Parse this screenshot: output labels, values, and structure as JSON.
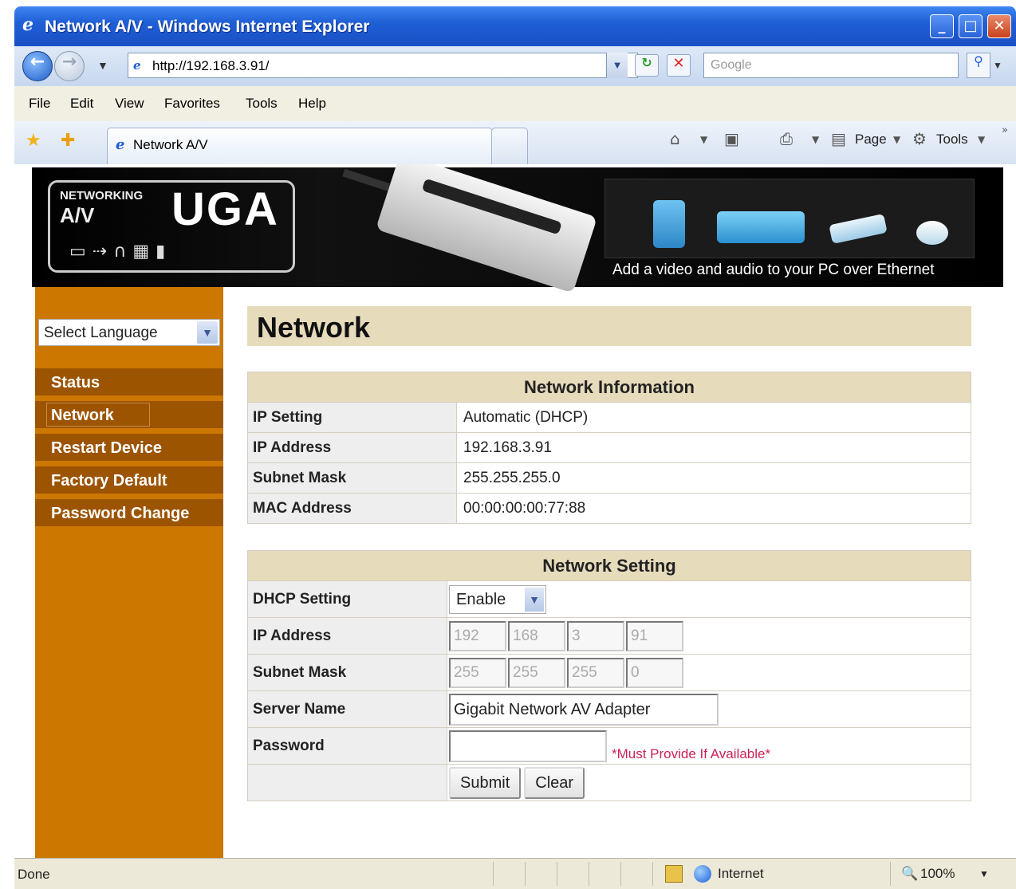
{
  "window": {
    "title": "Network A/V - Windows Internet Explorer",
    "minimize": "_",
    "maximize": "□",
    "close": "✕"
  },
  "address_bar": {
    "url": "http://192.168.3.91/",
    "search_placeholder": "Google"
  },
  "menu": [
    "File",
    "Edit",
    "View",
    "Favorites",
    "Tools",
    "Help"
  ],
  "tabs": {
    "active_tab_label": "Network A/V",
    "toolbar_page": "Page",
    "toolbar_tools": "Tools"
  },
  "banner": {
    "logo_networking": "NETWORKING",
    "logo_av": "A/V",
    "logo_uga": "UGA",
    "tagline": "Add a video and audio to your PC over Ethernet"
  },
  "sidebar": {
    "language_select": "Select Language",
    "items": [
      {
        "label": "Status"
      },
      {
        "label": "Network"
      },
      {
        "label": "Restart Device"
      },
      {
        "label": "Factory Default"
      },
      {
        "label": "Password Change"
      }
    ],
    "active": "Network"
  },
  "page": {
    "title": "Network"
  },
  "network_information": {
    "header": "Network Information",
    "rows": [
      {
        "label": "IP Setting",
        "value": "Automatic (DHCP)"
      },
      {
        "label": "IP Address",
        "value": "192.168.3.91"
      },
      {
        "label": "Subnet Mask",
        "value": "255.255.255.0"
      },
      {
        "label": "MAC Address",
        "value": "00:00:00:00:77:88"
      }
    ]
  },
  "network_setting": {
    "header": "Network Setting",
    "dhcp_label": "DHCP Setting",
    "dhcp_value": "Enable",
    "ip_label": "IP Address",
    "ip_octets": [
      "192",
      "168",
      "3",
      "91"
    ],
    "mask_label": "Subnet Mask",
    "mask_octets": [
      "255",
      "255",
      "255",
      "0"
    ],
    "server_name_label": "Server Name",
    "server_name_value": "Gigabit Network AV Adapter",
    "password_label": "Password",
    "password_value": "",
    "password_note": "*Must Provide If Available*",
    "submit_label": "Submit",
    "clear_label": "Clear"
  },
  "status_bar": {
    "status": "Done",
    "zone": "Internet",
    "zoom": "100%"
  },
  "colors": {
    "sidebar_bg": "#cc7700",
    "nav_item_bg": "#9c5400",
    "table_header_bg": "#e6dbbb",
    "required_note": "#cc2255"
  }
}
